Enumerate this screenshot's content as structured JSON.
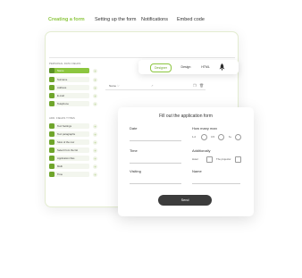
{
  "tabs": [
    "Creating a form",
    "Setting up the form",
    "Notifications",
    "Embed code"
  ],
  "active_tab": 0,
  "sections": {
    "personal": "PERSONAL DATA FIELDS",
    "additional": "ADD. FIELDS TYPES"
  },
  "personal_fields": [
    "Name",
    "Surname",
    "Address",
    "E-mail",
    "Telephone"
  ],
  "additional_fields": [
    "Text Settings",
    "Text paragraphs",
    "Slow of the row",
    "Select from the list",
    "Application files",
    "Multi",
    "Time"
  ],
  "toolbar": {
    "buttons": [
      "Designer",
      "Design",
      "HTML"
    ]
  },
  "field_row": {
    "name": "Name ♡",
    "arrow": "↗"
  },
  "form": {
    "title": "Fill out the application form",
    "date_label": "Date",
    "time_label": "Time",
    "visiting_label": "Visiting",
    "how_many_label": "How many man",
    "options": [
      "1-2",
      "3-5",
      "6+"
    ],
    "additional_label": "Additionally",
    "check_options": [
      "Hotel",
      "The projector"
    ],
    "name_label": "Name",
    "send_label": "Send"
  },
  "colors": {
    "accent": "#8cc63f",
    "dark_button": "#3c3c3c"
  }
}
